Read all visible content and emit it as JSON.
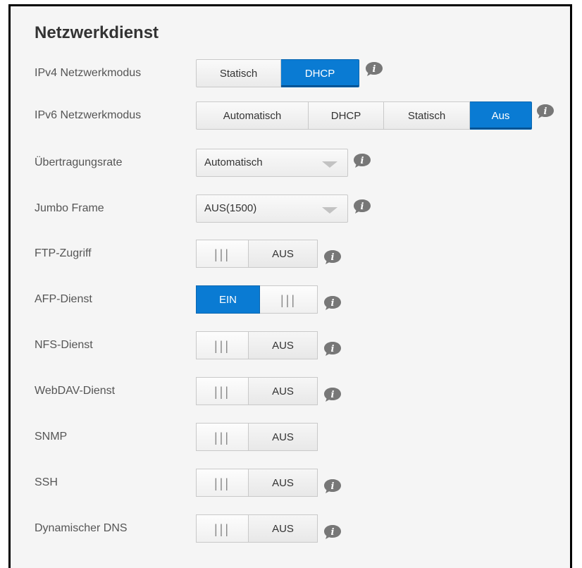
{
  "title": "Netzwerkdienst",
  "rows": {
    "ipv4": {
      "label": "IPv4 Netzwerkmodus",
      "options": [
        "Statisch",
        "DHCP"
      ],
      "selected": "DHCP"
    },
    "ipv6": {
      "label": "IPv6 Netzwerkmodus",
      "options": [
        "Automatisch",
        "DHCP",
        "Statisch",
        "Aus"
      ],
      "selected": "Aus"
    },
    "rate": {
      "label": "Übertragungsrate",
      "value": "Automatisch"
    },
    "jumbo": {
      "label": "Jumbo Frame",
      "value": "AUS(1500)"
    },
    "ftp": {
      "label": "FTP-Zugriff",
      "state": "AUS"
    },
    "afp": {
      "label": "AFP-Dienst",
      "state": "EIN"
    },
    "nfs": {
      "label": "NFS-Dienst",
      "state": "AUS"
    },
    "webdav": {
      "label": "WebDAV-Dienst",
      "state": "AUS"
    },
    "snmp": {
      "label": "SNMP",
      "state": "AUS"
    },
    "ssh": {
      "label": "SSH",
      "state": "AUS"
    },
    "ddns": {
      "label": "Dynamischer DNS",
      "state": "AUS"
    }
  },
  "toggle_grip": "|||",
  "icons": {
    "info": "info-icon"
  },
  "colors": {
    "accent": "#0a7bd3",
    "panel": "#f5f5f5",
    "info_icon": "#777777"
  }
}
